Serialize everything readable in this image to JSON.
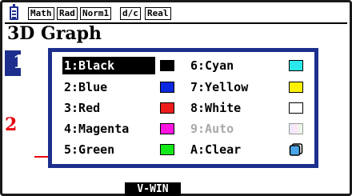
{
  "status_bar": {
    "badges": [
      "Math",
      "Rad",
      "Norm1",
      "d/c",
      "Real"
    ]
  },
  "background": {
    "title": "3D Graph",
    "row1_label": "1",
    "row2_label": "2",
    "paren": "(",
    "fkey_label": "V-WIN"
  },
  "color_menu": {
    "items": [
      {
        "label": "1:Black",
        "swatch": "#000000",
        "selected": true,
        "disabled": false
      },
      {
        "label": "2:Blue",
        "swatch": "#0b28e0",
        "selected": false,
        "disabled": false
      },
      {
        "label": "3:Red",
        "swatch": "#ef1c1c",
        "selected": false,
        "disabled": false
      },
      {
        "label": "4:Magenta",
        "swatch": "#ff14e0",
        "selected": false,
        "disabled": false
      },
      {
        "label": "5:Green",
        "swatch": "#12e81a",
        "selected": false,
        "disabled": false
      },
      {
        "label": "6:Cyan",
        "swatch": "#28e8ec",
        "selected": false,
        "disabled": false
      },
      {
        "label": "7:Yellow",
        "swatch": "#fff200",
        "selected": false,
        "disabled": false
      },
      {
        "label": "8:White",
        "swatch": "#ffffff",
        "selected": false,
        "disabled": false
      },
      {
        "label": "9:Auto",
        "swatch": "gradient",
        "selected": false,
        "disabled": true
      },
      {
        "label": "A:Clear",
        "swatch": "clear-icon",
        "selected": false,
        "disabled": false
      }
    ]
  }
}
